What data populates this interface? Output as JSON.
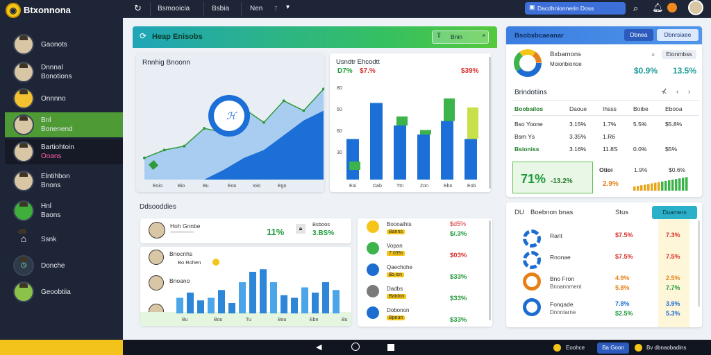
{
  "app": {
    "title": "Btxonnona"
  },
  "sidebar": {
    "items": [
      {
        "label": "Gaonots"
      },
      {
        "label": "Dnnnal",
        "sub": "Bonotions"
      },
      {
        "label": "Onnnno"
      },
      {
        "label": "Bnl",
        "sub": "Bonenend"
      },
      {
        "label": "Bartiohtoin",
        "sub": "Ooans"
      },
      {
        "label": "Elntihbon",
        "sub": "Bnons"
      },
      {
        "label": "Hnl",
        "sub": "Baons"
      },
      {
        "label": "Ssnk"
      },
      {
        "label": "Donche"
      },
      {
        "label": "Geoobtiia"
      }
    ]
  },
  "topbar": {
    "tabs": [
      "Bsmooicia",
      "Bsbia",
      "Nen"
    ],
    "tab_count": "7",
    "search_placeholder": "Dacdhnionnerin  Doss"
  },
  "banner": {
    "title": "Heap Enisobs",
    "btn": "Bnin"
  },
  "chart_main": {
    "title": "Rnnhig Bnoonn",
    "x": [
      "Eoio",
      "Bio",
      "Bu",
      "Eoo",
      "Ioio",
      "Ego"
    ]
  },
  "bar_panel": {
    "title": "Usndtr Ehcodtt",
    "stat1": "D7%",
    "stat2": "$7.%",
    "stat3": "$39%",
    "y": [
      "80",
      "50",
      "60",
      "30"
    ],
    "x": [
      "Eoi",
      "Dab",
      "Ttn",
      "Zon",
      "Ebn",
      "Eob"
    ]
  },
  "section": {
    "title": "Ddsooddies"
  },
  "row1": {
    "name": "Hoh Gnnbe",
    "pct": "11%",
    "label": "Bsboos",
    "val": "3.BS%"
  },
  "row2": {
    "name": "Bnocnhs",
    "sub": "Bo Rohen",
    "x": [
      "Bu",
      "Bou",
      "Tu",
      "Bou",
      "Ebn",
      "Bu"
    ]
  },
  "row3": {
    "name": "Bnoano"
  },
  "mid_list": {
    "items": [
      {
        "name": "Boooaihts",
        "sub": "Banns",
        "a": "$d5%",
        "b": "$/.3%"
      },
      {
        "name": "Vopan",
        "sub": "7.03%",
        "a": "",
        "b": "$03%"
      },
      {
        "name": "Qaechohe",
        "sub": "$b.ion",
        "a": "",
        "b": "$33%"
      },
      {
        "name": "Dadbs",
        "sub": "Batdon",
        "a": "",
        "b": "$33%"
      },
      {
        "name": "Dobonon",
        "sub": "Bpeun",
        "a": "",
        "b": "$33%"
      }
    ]
  },
  "right": {
    "title": "Bsobxbcaeanar",
    "btn1": "Dbnea",
    "btn2": "Dbnrsiaee",
    "donut_title": "Bxbamons",
    "donut_sub": "Moionbionoe",
    "stat_btn": "Eionmbss",
    "v1": "$0.9%",
    "v2": "13.5%",
    "table_title": "Brindotiins",
    "head": [
      "Boobailos",
      "Daoue",
      "Ihsss",
      "Boibe",
      "Ebooa"
    ],
    "rows": [
      [
        "Bso Yoone",
        "3.15%",
        "1.7%",
        "5.5%",
        "$5.8%"
      ],
      [
        "Bsm Ys",
        "3.35%",
        "1.R6",
        "",
        ""
      ],
      [
        "Bsioniss",
        "3.16%",
        "11.8S",
        "0.0%",
        "$5%"
      ]
    ],
    "big": "71%",
    "big2": "-13.2%",
    "mini_title": "Otioi",
    "mini_a": "1.9%",
    "mini_b": "$0.6%",
    "mini_c": "2.9%"
  },
  "rlist": {
    "c1": "DU",
    "c2": "Boebnon bnas",
    "c3": "Stus",
    "btn": "Duamers",
    "items": [
      {
        "name": "Rant",
        "sub": "",
        "a": "$7.5%",
        "b": "7.3%"
      },
      {
        "name": "Rnonae",
        "sub": "",
        "a": "$7.5%",
        "b": "7.5%"
      },
      {
        "name": "Bno Fron",
        "sub": "Bnoannment",
        "a": "4.9%",
        "b": "2.5%",
        "a2": "5.8%",
        "b2": "7.7%"
      },
      {
        "name": "Fonqade",
        "sub": "Dnnntarne",
        "a": "7.8%",
        "b": "3.9%",
        "a2": "$2.5%",
        "b2": "5.3%"
      }
    ]
  },
  "footer": {
    "b1": "Eoohce",
    "b2": "Ba Goon",
    "b3": "Bv dbnaobadins"
  },
  "colors": {
    "sidebar": "#1e2536",
    "accent_green": "#4e9a35",
    "blue": "#1d6dd1",
    "teal": "#2bb0c9",
    "yellow": "#f3c21b"
  },
  "chart_data": [
    {
      "type": "area",
      "title": "Rnnhig Bnoonn",
      "categories": [
        "Eoio",
        "Bio",
        "Bu",
        "Eoo",
        "Ioio",
        "Ego"
      ],
      "series": [
        {
          "values": [
            22,
            30,
            34,
            52,
            48,
            72,
            58,
            80,
            70,
            92
          ]
        },
        {
          "values": [
            0,
            0,
            0,
            0,
            10,
            22,
            30,
            45,
            60,
            70
          ]
        }
      ]
    },
    {
      "type": "bar",
      "title": "Usndtr Ehcodtt",
      "categories": [
        "Eoi",
        "Dab",
        "Ttn",
        "Zon",
        "Ebn",
        "Eob"
      ],
      "series": [
        {
          "values": [
            45,
            85,
            60,
            50,
            65,
            45
          ]
        },
        {
          "values": [
            20,
            0,
            70,
            55,
            90,
            80
          ]
        }
      ]
    },
    {
      "type": "bar",
      "categories": [
        "Bu",
        "Bou",
        "Tu",
        "Bou",
        "Ebn",
        "Bu"
      ],
      "values": [
        30,
        40,
        25,
        30,
        45,
        20,
        60,
        80,
        85,
        60,
        35,
        30,
        50,
        40,
        60,
        45
      ]
    }
  ]
}
